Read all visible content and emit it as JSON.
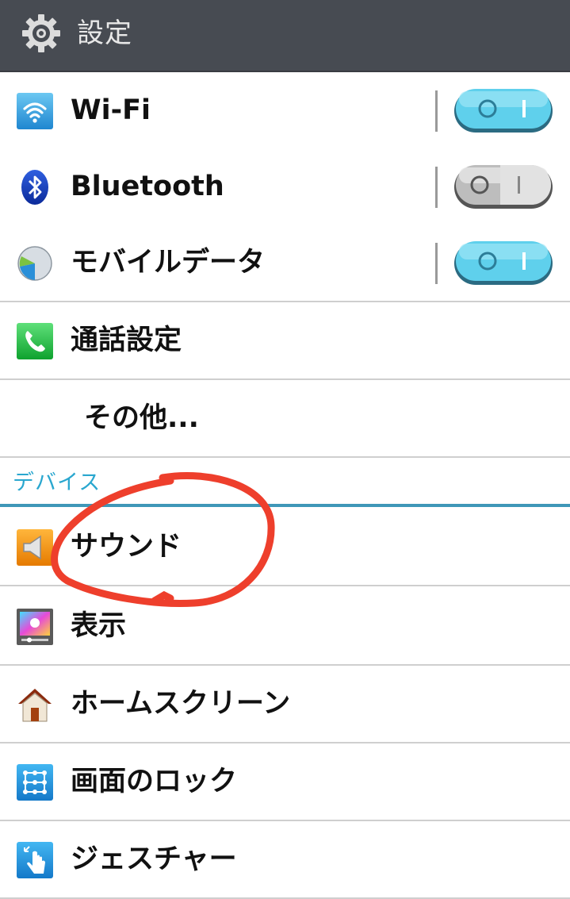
{
  "header": {
    "title": "設定"
  },
  "wireless": [
    {
      "label": "Wi-Fi",
      "icon": "wifi-icon",
      "toggle": "on"
    },
    {
      "label": "Bluetooth",
      "icon": "bluetooth-icon",
      "toggle": "off"
    },
    {
      "label": "モバイルデータ",
      "icon": "mobile-data-icon",
      "toggle": "on"
    },
    {
      "label": "通話設定",
      "icon": "phone-icon"
    },
    {
      "label": "その他..."
    }
  ],
  "section": {
    "label": "デバイス"
  },
  "device": [
    {
      "label": "サウンド",
      "icon": "speaker-icon"
    },
    {
      "label": "表示",
      "icon": "display-icon"
    },
    {
      "label": "ホームスクリーン",
      "icon": "home-icon"
    },
    {
      "label": "画面のロック",
      "icon": "lock-pattern-icon"
    },
    {
      "label": "ジェスチャー",
      "icon": "gesture-icon"
    }
  ],
  "colors": {
    "titlebar": "#474b52",
    "accent": "#2aa7cf",
    "toggle_on": "#5fd0ec",
    "annotation": "#ee3f2c"
  }
}
